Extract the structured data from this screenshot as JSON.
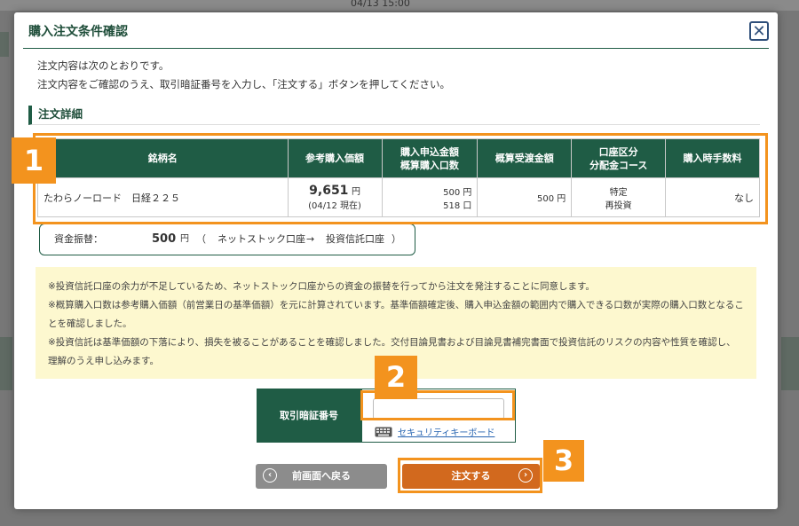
{
  "background": {
    "timestamp": "04/13 15:00"
  },
  "modal": {
    "title": "購入注文条件確認",
    "close_symbol": "✕",
    "intro": [
      "注文内容は次のとおりです。",
      "注文内容をご確認のうえ、取引暗証番号を入力し、「注文する」ボタンを押してください。"
    ],
    "section_title": "注文詳細"
  },
  "order_table": {
    "headers": [
      "銘柄名",
      "参考購入価額",
      "購入申込金額\n概算購入口数",
      "概算受渡金額",
      "口座区分\n分配金コース",
      "購入時手数料"
    ],
    "row": {
      "name": "たわらノーロード　日経２２５",
      "price": "9,651",
      "price_unit": "円",
      "price_date": "(04/12 現在)",
      "apply_amount": "500",
      "apply_amount_unit": "円",
      "units": "518",
      "units_unit": "口",
      "settlement": "500",
      "settlement_unit": "円",
      "account": "特定",
      "course": "再投資",
      "fee": "なし"
    }
  },
  "transfer": {
    "label": "資金振替：",
    "amount": "500",
    "unit": "円",
    "paren_open": "（",
    "from": "ネットストック口座",
    "arrow": "→",
    "to": "投資信託口座",
    "paren_close": "）"
  },
  "notes": [
    "※投資信託口座の余力が不足しているため、ネットストック口座からの資金の振替を行ってから注文を発注することに同意します。",
    "※概算購入口数は参考購入価額（前営業日の基準価額）を元に計算されています。基準価額確定後、購入申込金額の範囲内で購入できる口数が実際の購入口数となることを確認しました。",
    "※投資信託は基準価額の下落により、損失を被ることがあることを確認しました。交付目論見書および目論見書補完書面で投資信託のリスクの内容や性質を確認し、理解のうえ申し込みます。"
  ],
  "pin": {
    "label": "取引暗証番号",
    "value": "",
    "placeholder": "",
    "keyboard_link": "セキュリティキーボード"
  },
  "buttons": {
    "back": "前画面へ戻る",
    "back_icon": "‹",
    "order": "注文する",
    "order_icon": "›"
  },
  "callouts": [
    "1",
    "2",
    "3"
  ],
  "colors": {
    "primary_green": "#1f5c45",
    "accent_orange": "#f3931e",
    "order_button": "#d2691e",
    "notes_bg": "#fdf8cf"
  }
}
